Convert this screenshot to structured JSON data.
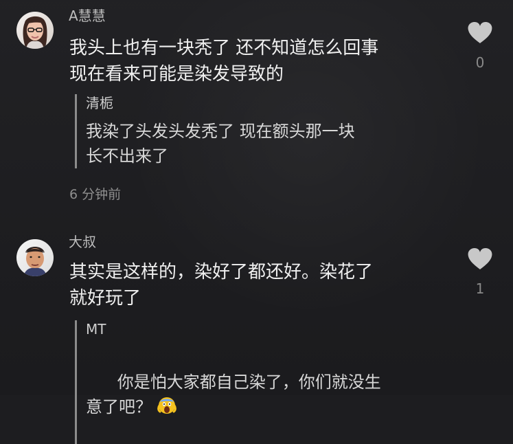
{
  "comments": [
    {
      "username": "A慧慧",
      "text": "我头上也有一块秃了 还不知道怎么回事\n现在看来可能是染发导致的",
      "likes": "0",
      "reply": {
        "username": "清栀",
        "text": "我染了头发头发秃了 现在额头那一块\n长不出来了"
      },
      "timestamp": "6 分钟前"
    },
    {
      "username": "大叔",
      "text": "其实是这样的，染好了都还好。染花了\n就好玩了",
      "likes": "1",
      "reply": {
        "username": "MT",
        "text": "你是怕大家都自己染了，你们就没生\n意了吧？"
      }
    }
  ],
  "colors": {
    "background": "#1d1d20",
    "primary_text": "#f0f0f0",
    "secondary_text": "#bdbdbd",
    "muted_text": "#8f8f8f",
    "reply_border": "#8c8c8c",
    "heart": "#c8c8c8"
  },
  "icons": {
    "like": "heart-icon",
    "emoji": "screaming-face-emoji-icon"
  }
}
